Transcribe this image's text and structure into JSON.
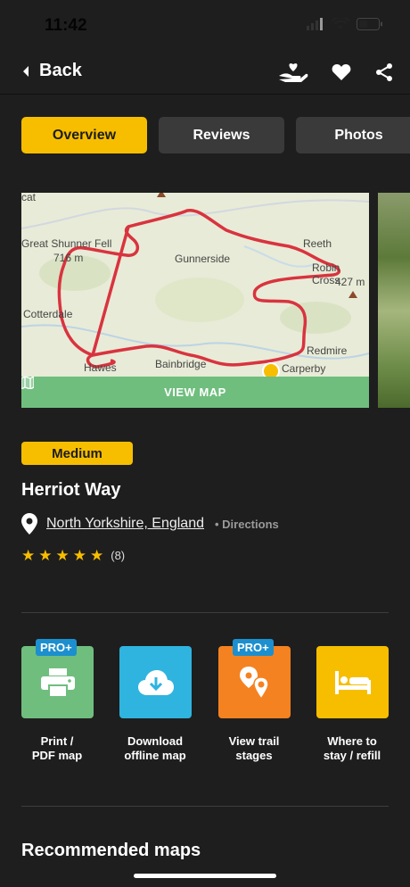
{
  "status_bar": {
    "time": "11:42"
  },
  "nav": {
    "back_label": "Back"
  },
  "tabs": [
    {
      "label": "Overview",
      "active": true
    },
    {
      "label": "Reviews",
      "active": false
    },
    {
      "label": "Photos",
      "active": false
    }
  ],
  "map": {
    "labels": [
      "Great Shunner Fell",
      "716 m",
      "Gunnerside",
      "Reeth",
      "Robin Cross",
      "427 m",
      "Cotterdale",
      "Redmire",
      "Bainbridge",
      "Hawes",
      "Carperby"
    ],
    "view_map_label": "VIEW MAP",
    "route_color": "#d9333f"
  },
  "trail": {
    "difficulty": "Medium",
    "name": "Herriot Way",
    "location": "North Yorkshire, England",
    "directions_label": "• Directions",
    "rating_count": "(8)",
    "stars": 5
  },
  "actions": [
    {
      "label": "Print /\nPDF map",
      "pro": true,
      "pro_label": "PRO+",
      "color": "#6fbe7e",
      "icon": "printer-icon"
    },
    {
      "label": "Download\noffline map",
      "pro": false,
      "color": "#2fb4e0",
      "icon": "cloud-download-icon"
    },
    {
      "label": "View trail\nstages",
      "pro": true,
      "pro_label": "PRO+",
      "color": "#f58220",
      "icon": "map-pins-icon"
    },
    {
      "label": "Where to\nstay / refill",
      "pro": false,
      "color": "#f7be00",
      "icon": "bed-icon"
    }
  ],
  "sections": {
    "recommended_maps": "Recommended maps"
  },
  "colors": {
    "accent": "#f7be00",
    "background": "#1e1e1e",
    "tab_inactive": "#3a3a3a"
  }
}
